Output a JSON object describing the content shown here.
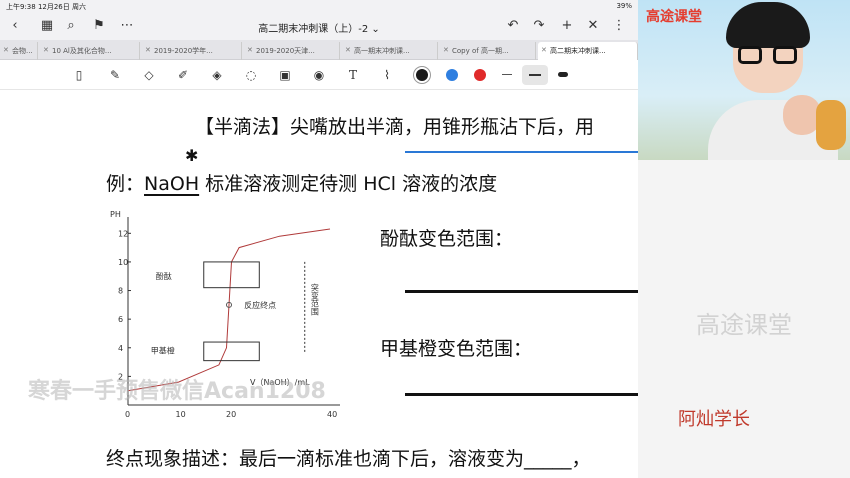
{
  "status": {
    "time_date": "上午9:38  12月26日 周六",
    "battery": "39%"
  },
  "window": {
    "title": "高二期末冲刺课（上）-2 ⌄"
  },
  "tabs": [
    {
      "label": "会物..."
    },
    {
      "label": "10 Al及其化合物..."
    },
    {
      "label": "2019-2020学年..."
    },
    {
      "label": "2019-2020天津..."
    },
    {
      "label": "高一期末冲刺课..."
    },
    {
      "label": "Copy of 高一期..."
    },
    {
      "label": "高二期末冲刺课..."
    }
  ],
  "toolbar": {
    "icons": [
      "layout-icon",
      "pen-icon",
      "eraser-icon",
      "highlighter-icon",
      "shapes-icon",
      "lasso-icon",
      "image-icon",
      "camera-icon",
      "text-icon",
      "brush-icon"
    ],
    "colors": [
      "#1a1a1a",
      "#2f7fe0",
      "#e02a2a"
    ]
  },
  "content": {
    "header": "【半滴法】尖嘴放出半滴，用锥形瓶沾下后，用",
    "example_prefix": "例：",
    "example_naoh": "NaOH",
    "example_rest": " 标准溶液测定待测  HCl  溶液的浓度",
    "phenol_label": "酚酞变色范围：",
    "methyl_label": "甲基橙变色范围：",
    "endpoint": "终点现象描述：最后一滴标准也滴下后，溶液变为_____，",
    "watermark": "寒春一手预售微信Acan1208"
  },
  "chart_data": {
    "type": "line",
    "ylabel": "PH",
    "xlabel": "V（NaOH）/mL",
    "y_ticks": [
      "2",
      "4",
      "6",
      "8",
      "10",
      "12"
    ],
    "x_ticks": [
      "0",
      "10",
      "20",
      "40"
    ],
    "xlim": [
      0,
      40
    ],
    "ylim": [
      0,
      13
    ],
    "x": [
      0,
      10,
      18,
      19.5,
      20,
      20.5,
      22,
      30,
      40
    ],
    "y": [
      1,
      1.6,
      2.8,
      4,
      7,
      10,
      11,
      11.8,
      12.3
    ],
    "annotations": {
      "phenol": "酚酞",
      "methyl": "甲基橙",
      "endpoint": "反应终点",
      "jump": "突变范围"
    }
  },
  "side": {
    "brand": "高途课堂",
    "watermark": "高途课堂",
    "teacher_name": "阿灿学长"
  }
}
